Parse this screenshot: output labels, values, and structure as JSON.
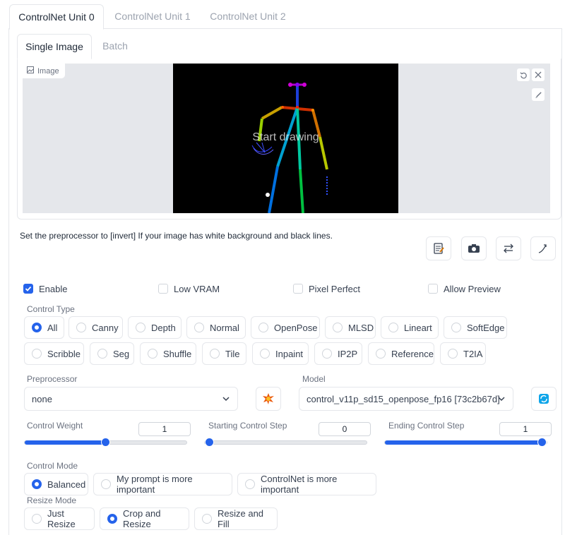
{
  "units_tabs": [
    "ControlNet Unit 0",
    "ControlNet Unit 1",
    "ControlNet Unit 2"
  ],
  "image_tabs": [
    "Single Image",
    "Batch"
  ],
  "image": {
    "label": "Image",
    "overlay": "Start drawing"
  },
  "hint": "Set the preprocessor to [invert] If your image has white background and black lines.",
  "checks": {
    "enable": "Enable",
    "low_vram": "Low VRAM",
    "pixel_perfect": "Pixel Perfect",
    "allow_preview": "Allow Preview"
  },
  "control_type": {
    "label": "Control Type",
    "options": [
      "All",
      "Canny",
      "Depth",
      "Normal",
      "OpenPose",
      "MLSD",
      "Lineart",
      "SoftEdge",
      "Scribble",
      "Seg",
      "Shuffle",
      "Tile",
      "Inpaint",
      "IP2P",
      "Reference",
      "T2IA"
    ],
    "selected": "All"
  },
  "preprocessor": {
    "label": "Preprocessor",
    "value": "none"
  },
  "model": {
    "label": "Model",
    "value": "control_v11p_sd15_openpose_fp16 [73c2b67d]"
  },
  "control_weight": {
    "label": "Control Weight",
    "value": "1",
    "fraction": 0.5
  },
  "starting_step": {
    "label": "Starting Control Step",
    "value": "0",
    "fraction": 0
  },
  "ending_step": {
    "label": "Ending Control Step",
    "value": "1",
    "fraction": 1
  },
  "control_mode": {
    "label": "Control Mode",
    "options": [
      "Balanced",
      "My prompt is more important",
      "ControlNet is more important"
    ],
    "selected": "Balanced"
  },
  "resize_mode": {
    "label": "Resize Mode",
    "options": [
      "Just Resize",
      "Crop and Resize",
      "Resize and Fill"
    ],
    "selected": "Crop and Resize"
  },
  "colors": {
    "accent": "#2563eb",
    "border": "#e5e7eb",
    "image_bg": "#e5e7eb"
  }
}
